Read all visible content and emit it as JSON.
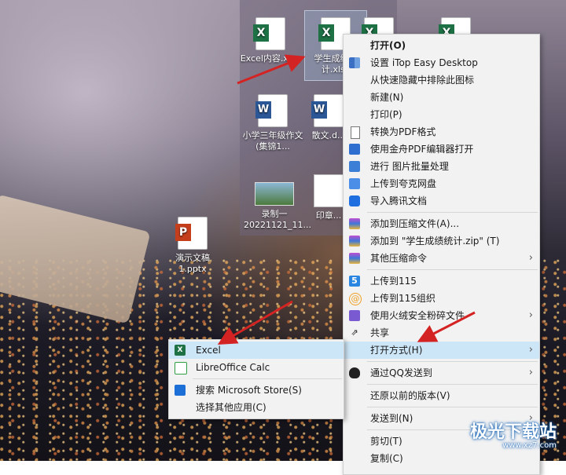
{
  "desktop": {
    "icons": [
      {
        "label": "Excel内容.xlsx",
        "type": "excel"
      },
      {
        "label": "学生成绩统计.xlsx",
        "type": "excel",
        "selected": true
      },
      {
        "label": "",
        "type": "excel"
      },
      {
        "label": "",
        "type": "excel"
      },
      {
        "label": "小学三年级作文(集锦1...",
        "type": "word"
      },
      {
        "label": "散文.d...",
        "type": "word"
      },
      {
        "label": "录制一 20221121_11...",
        "type": "video"
      },
      {
        "label": "印章...",
        "type": "file"
      },
      {
        "label": "演示文稿1.pptx",
        "type": "ppt"
      }
    ]
  },
  "context_menu": {
    "items": [
      {
        "label": "打开(O)",
        "icon": "",
        "bold": true
      },
      {
        "label": "设置 iTop Easy Desktop",
        "icon": "grid-icon"
      },
      {
        "label": "从快速隐藏中排除此图标",
        "icon": ""
      },
      {
        "label": "新建(N)",
        "icon": ""
      },
      {
        "label": "打印(P)",
        "icon": ""
      },
      {
        "label": "转换为PDF格式",
        "icon": "document-icon"
      },
      {
        "label": "使用金舟PDF编辑器打开",
        "icon": "pdf-icon"
      },
      {
        "label": "进行 图片批量处理",
        "icon": "image-icon"
      },
      {
        "label": "上传到夸克网盘",
        "icon": "cloud-icon"
      },
      {
        "label": "导入腾讯文档",
        "icon": "tencent-docs-icon"
      },
      {
        "label": "添加到压缩文件(A)...",
        "icon": "archive-icon"
      },
      {
        "label": "添加到 \"学生成绩统计.zip\" (T)",
        "icon": "archive-icon"
      },
      {
        "label": "其他压缩命令",
        "icon": "archive-icon",
        "submenu": true
      },
      {
        "label": "上传到115",
        "icon": "115-icon"
      },
      {
        "label": "上传到115组织",
        "icon": "115-org-icon"
      },
      {
        "label": "使用火绒安全粉碎文件",
        "icon": "shred-icon",
        "submenu": true
      },
      {
        "label": "共享",
        "icon": "share-icon"
      },
      {
        "label": "打开方式(H)",
        "icon": "",
        "submenu": true,
        "highlighted": true
      },
      {
        "label": "通过QQ发送到",
        "icon": "qq-icon",
        "submenu": true
      },
      {
        "label": "还原以前的版本(V)",
        "icon": ""
      },
      {
        "label": "发送到(N)",
        "icon": "",
        "submenu": true
      },
      {
        "label": "剪切(T)",
        "icon": ""
      },
      {
        "label": "复制(C)",
        "icon": ""
      }
    ]
  },
  "open_with_menu": {
    "items": [
      {
        "label": "Excel",
        "icon": "excel-icon",
        "highlighted": true
      },
      {
        "label": "LibreOffice Calc",
        "icon": "libreoffice-calc-icon"
      },
      {
        "label": "搜索 Microsoft Store(S)",
        "icon": "store-icon"
      },
      {
        "label": "选择其他应用(C)",
        "icon": ""
      }
    ]
  },
  "watermark": {
    "text": "极光下载站",
    "sub": "www.xz7.com"
  },
  "colors": {
    "highlight": "#cde6f7",
    "menu_bg": "#f2f2f2",
    "arrow": "#d42323"
  }
}
